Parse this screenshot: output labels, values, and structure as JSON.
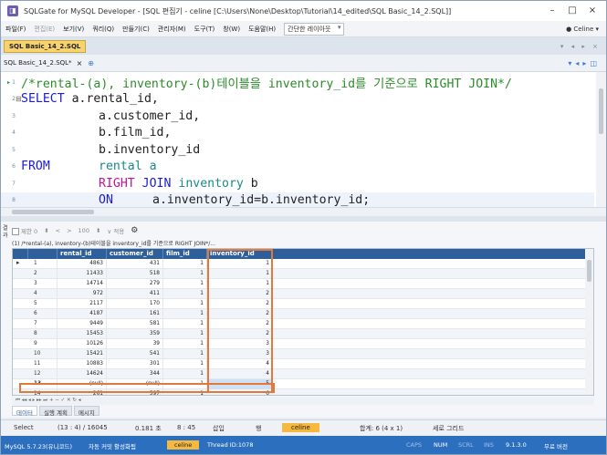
{
  "window": {
    "title": "SQLGate for MySQL Developer - [SQL 편집기 - celine [C:\\Users\\None\\Desktop\\Tutorial\\14_edited\\SQL Basic_14_2.SQL]]",
    "minimize": "–",
    "maximize": "□",
    "close": "×"
  },
  "menu": {
    "items": [
      "파일(F)",
      "편집(E)",
      "보기(V)",
      "쿼리(Q)",
      "만들기(C)",
      "관리자(M)",
      "도구(T)",
      "창(W)",
      "도움말(H)"
    ],
    "layout_select": "간단한 레이아웃",
    "user": "Celine"
  },
  "doc_tab": {
    "label": "SQL Basic_14_2.SQL"
  },
  "file_tab": {
    "label": "SQL Basic_14_2.SQL*",
    "close": "×"
  },
  "editor": {
    "lines": [
      {
        "num": "1",
        "text": "/*rental-(a), inventory-(b)테이블을 inventory_id를 기준으로 RIGHT JOIN*/"
      },
      {
        "num": "2",
        "kw": "SELECT",
        "rest": " a.rental_id,"
      },
      {
        "num": "3",
        "rest": "a.customer_id,"
      },
      {
        "num": "4",
        "rest": "b.film_id,"
      },
      {
        "num": "5",
        "rest": "b.inventory_id"
      },
      {
        "num": "6",
        "kw": "FROM",
        "table": "rental a"
      },
      {
        "num": "7",
        "kw2": "RIGHT",
        "kw": "JOIN",
        "table": "inventory",
        "alias": "b"
      },
      {
        "num": "8",
        "kw": "ON",
        "rest": "a.inventory_id=b.inventory_id;"
      }
    ]
  },
  "results": {
    "side_label": "결과",
    "toolbar": {
      "limit_label": "제한",
      "limit_value": "0",
      "page_size": "100",
      "apply": "적용"
    },
    "caption": "(1) /*rental-(a), inventory-(b)테이블을 inventory_id를 기준으로 RIGHT JOIN*/...",
    "columns": [
      "rental_id",
      "customer_id",
      "film_id",
      "inventory_id"
    ],
    "rows": [
      [
        "1",
        "4863",
        "431",
        "1",
        "1"
      ],
      [
        "2",
        "11433",
        "518",
        "1",
        "1"
      ],
      [
        "3",
        "14714",
        "279",
        "1",
        "1"
      ],
      [
        "4",
        "972",
        "411",
        "1",
        "2"
      ],
      [
        "5",
        "2117",
        "170",
        "1",
        "2"
      ],
      [
        "6",
        "4187",
        "161",
        "1",
        "2"
      ],
      [
        "7",
        "9449",
        "581",
        "1",
        "2"
      ],
      [
        "8",
        "15453",
        "359",
        "1",
        "2"
      ],
      [
        "9",
        "10126",
        "39",
        "1",
        "3"
      ],
      [
        "10",
        "15421",
        "541",
        "1",
        "3"
      ],
      [
        "11",
        "10883",
        "301",
        "1",
        "4"
      ],
      [
        "12",
        "14624",
        "344",
        "1",
        "4"
      ],
      [
        "13",
        "(null)",
        "(null)",
        "1",
        "5"
      ],
      [
        "14",
        "261",
        "597",
        "1",
        "6"
      ]
    ],
    "tabs": [
      "데이터",
      "실행 계획",
      "메시지"
    ]
  },
  "status": {
    "mode": "Select",
    "rows": "(13 : 4) / 16045",
    "time": "0.181 초",
    "clock": "8 : 45",
    "insert": "삽입",
    "row_label": "행",
    "user": "celine",
    "selection": "합계: 6 (4 x 1)",
    "grid": "세로 그리드"
  },
  "bottom": {
    "server": "MySQL 5.7.23(유니코드)",
    "autocommit": "자동 커밋 활성화됨",
    "user": "celine",
    "thread": "Thread ID:1078",
    "caps": "CAPS",
    "num": "NUM",
    "scrl": "SCRL",
    "ins": "INS",
    "version": "9.1.3.0",
    "edition": "무료 버전"
  },
  "colors": {
    "accent": "#2d6fbf",
    "grid_header": "#2e5f9a",
    "highlight": "#e07a3a",
    "user_badge": "#f6b83e"
  }
}
